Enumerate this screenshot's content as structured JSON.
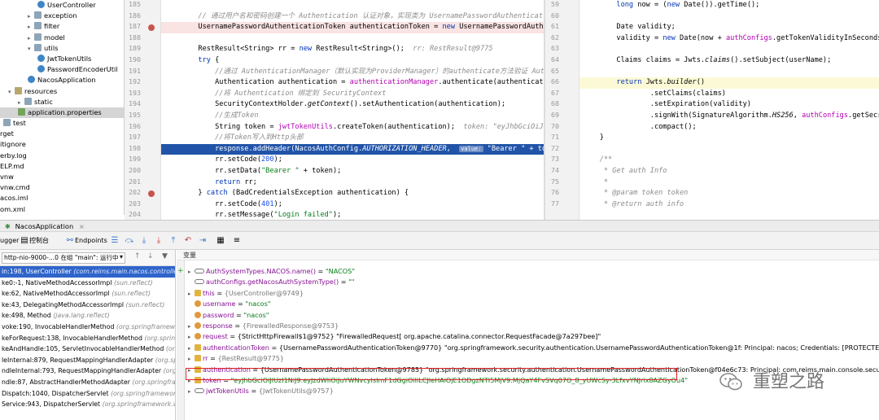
{
  "tree": {
    "items": [
      {
        "label": "UserController",
        "icon": "class-icon",
        "indent": 3
      },
      {
        "label": "exception",
        "icon": "folder-icon",
        "arrow": "▸",
        "indent": 2
      },
      {
        "label": "filter",
        "icon": "folder-icon",
        "arrow": "▸",
        "indent": 2
      },
      {
        "label": "model",
        "icon": "folder-icon",
        "arrow": "▸",
        "indent": 2
      },
      {
        "label": "utils",
        "icon": "folder-icon",
        "arrow": "▾",
        "indent": 2
      },
      {
        "label": "JwtTokenUtils",
        "icon": "class-icon",
        "indent": 3
      },
      {
        "label": "PasswordEncoderUtil",
        "icon": "class-icon",
        "indent": 3
      },
      {
        "label": "NacosApplication",
        "icon": "class-icon",
        "indent": 2
      },
      {
        "label": "resources",
        "icon": "resources-icon",
        "arrow": "▾",
        "indent": 0
      },
      {
        "label": "static",
        "icon": "folder-icon",
        "arrow": "▸",
        "indent": 1
      },
      {
        "label": "application.properties",
        "icon": "properties-icon",
        "indent": 1,
        "selected": true
      },
      {
        "label": "test",
        "icon": "folder-icon",
        "indent": -1
      },
      {
        "label": "rget",
        "icon": "",
        "indent": -2
      },
      {
        "label": "itignore",
        "icon": "",
        "indent": -2
      },
      {
        "label": "erby.log",
        "icon": "",
        "indent": -2
      },
      {
        "label": "ELP.md",
        "icon": "",
        "indent": -2
      },
      {
        "label": "vnw",
        "icon": "",
        "indent": -2
      },
      {
        "label": "vnw.cmd",
        "icon": "",
        "indent": -2
      },
      {
        "label": "acos.iml",
        "icon": "",
        "indent": -2
      },
      {
        "label": "om.xml",
        "icon": "",
        "indent": -2
      }
    ]
  },
  "editor_left": {
    "line_numbers": [
      "185",
      "186",
      "187",
      "188",
      "189",
      "190",
      "191",
      "192",
      "193",
      "194",
      "195",
      "196",
      "197",
      "198",
      "199",
      "200",
      "201",
      "202",
      "203",
      "204"
    ],
    "breakpoints": [
      "187",
      "202"
    ],
    "lines": [
      {
        "html_class": "",
        "parts": []
      },
      {
        "html_class": "",
        "parts": [
          {
            "c": "cm",
            "t": "        // 通过用户名和密码创建一个 Authentication 认证对象，实现类为 UsernamePasswordAuthenticat"
          }
        ]
      },
      {
        "html_class": "err",
        "parts": [
          {
            "c": "",
            "t": "        UsernamePasswordAuthenticationToken authenticationToken = "
          },
          {
            "c": "kw",
            "t": "new"
          },
          {
            "c": "",
            "t": " UsernamePasswordAuth"
          }
        ]
      },
      {
        "html_class": "",
        "parts": []
      },
      {
        "html_class": "",
        "parts": [
          {
            "c": "",
            "t": "        RestResult<String> rr = "
          },
          {
            "c": "kw",
            "t": "new"
          },
          {
            "c": "",
            "t": " RestResult<String>();  "
          },
          {
            "c": "hint",
            "t": "rr: RestResult@9775"
          }
        ]
      },
      {
        "html_class": "",
        "parts": [
          {
            "c": "kw",
            "t": "        try"
          },
          {
            "c": "",
            "t": " {"
          }
        ]
      },
      {
        "html_class": "",
        "parts": [
          {
            "c": "cm",
            "t": "            //通过 AuthenticationManager（默认实现为ProviderManager）的authenticate方法验证 Aut"
          }
        ]
      },
      {
        "html_class": "",
        "parts": [
          {
            "c": "",
            "t": "            Authentication authentication = "
          },
          {
            "c": "fn",
            "t": "authenticationManager"
          },
          {
            "c": "",
            "t": ".authenticate(authenticati"
          }
        ]
      },
      {
        "html_class": "",
        "parts": [
          {
            "c": "cm",
            "t": "            //将 Authentication 绑定到 SecurityContext"
          }
        ]
      },
      {
        "html_class": "",
        "parts": [
          {
            "c": "",
            "t": "            SecurityContextHolder."
          },
          {
            "c": "it",
            "t": "getContext"
          },
          {
            "c": "",
            "t": "().setAuthentication(authentication);"
          }
        ]
      },
      {
        "html_class": "",
        "parts": [
          {
            "c": "cm",
            "t": "            //生成Token"
          }
        ]
      },
      {
        "html_class": "",
        "parts": [
          {
            "c": "",
            "t": "            String token = "
          },
          {
            "c": "fn",
            "t": "jwtTokenUtils"
          },
          {
            "c": "",
            "t": ".createToken(authentication);  "
          },
          {
            "c": "hint",
            "t": "token: \"eyJhbGciOiJ"
          }
        ]
      },
      {
        "html_class": "",
        "parts": [
          {
            "c": "cm",
            "t": "            //将Token写入到Http头部"
          }
        ]
      },
      {
        "html_class": "cur",
        "parts": [
          {
            "c": "",
            "t": "            response.addHeader(NacosAuthConfig."
          },
          {
            "c": "it",
            "t": "AUTHORIZATION_HEADER"
          },
          {
            "c": "",
            "t": ",  "
          },
          {
            "c": "valchip",
            "t": "value:"
          },
          {
            "c": "",
            "t": " \"Bearer \" + tok"
          }
        ]
      },
      {
        "html_class": "",
        "parts": [
          {
            "c": "",
            "t": "            rr.setCode("
          },
          {
            "c": "nm",
            "t": "200"
          },
          {
            "c": "",
            "t": ");"
          }
        ]
      },
      {
        "html_class": "",
        "parts": [
          {
            "c": "",
            "t": "            rr.setData("
          },
          {
            "c": "st",
            "t": "\"Bearer \""
          },
          {
            "c": "",
            "t": " + token);"
          }
        ]
      },
      {
        "html_class": "",
        "parts": [
          {
            "c": "kw",
            "t": "            return"
          },
          {
            "c": "",
            "t": " rr;"
          }
        ]
      },
      {
        "html_class": "",
        "parts": [
          {
            "c": "",
            "t": "        } "
          },
          {
            "c": "kw",
            "t": "catch"
          },
          {
            "c": "",
            "t": " (BadCredentialsException authentication) {"
          }
        ]
      },
      {
        "html_class": "",
        "parts": [
          {
            "c": "",
            "t": "            rr.setCode("
          },
          {
            "c": "nm",
            "t": "401"
          },
          {
            "c": "",
            "t": ");"
          }
        ]
      },
      {
        "html_class": "",
        "parts": [
          {
            "c": "",
            "t": "            rr.setMessage("
          },
          {
            "c": "st",
            "t": "\"Login failed\""
          },
          {
            "c": "",
            "t": ");"
          }
        ]
      }
    ]
  },
  "editor_right": {
    "line_numbers": [
      "59",
      "60",
      "61",
      "62",
      "63",
      "64",
      "65",
      "66",
      "67",
      "68",
      "69",
      "70",
      "71",
      "72",
      "73",
      "74",
      "75",
      "76",
      "77"
    ],
    "lines": [
      {
        "html_class": "",
        "parts": [
          {
            "c": "",
            "t": "        "
          },
          {
            "c": "kw",
            "t": "long"
          },
          {
            "c": "",
            "t": " now = ("
          },
          {
            "c": "kw",
            "t": "new"
          },
          {
            "c": "",
            "t": " Date()).getTime();"
          }
        ]
      },
      {
        "html_class": "",
        "parts": []
      },
      {
        "html_class": "",
        "parts": [
          {
            "c": "",
            "t": "        Date validity;"
          }
        ]
      },
      {
        "html_class": "",
        "parts": [
          {
            "c": "",
            "t": "        validity = "
          },
          {
            "c": "kw",
            "t": "new"
          },
          {
            "c": "",
            "t": " Date(now + "
          },
          {
            "c": "fn",
            "t": "authConfigs"
          },
          {
            "c": "",
            "t": ".getTokenValidityInSeconds"
          }
        ]
      },
      {
        "html_class": "",
        "parts": []
      },
      {
        "html_class": "",
        "parts": [
          {
            "c": "",
            "t": "        Claims claims = Jwts."
          },
          {
            "c": "it",
            "t": "claims"
          },
          {
            "c": "",
            "t": "().setSubject(userName);"
          }
        ]
      },
      {
        "html_class": "",
        "parts": []
      },
      {
        "html_class": "cur2",
        "parts": [
          {
            "c": "kw",
            "t": "        return"
          },
          {
            "c": "",
            "t": " Jwts."
          },
          {
            "c": "it",
            "t": "builder"
          },
          {
            "c": "",
            "t": "()"
          }
        ]
      },
      {
        "html_class": "",
        "parts": [
          {
            "c": "",
            "t": "                .setClaims(claims)"
          }
        ]
      },
      {
        "html_class": "",
        "parts": [
          {
            "c": "",
            "t": "                .setExpiration(validity)"
          }
        ]
      },
      {
        "html_class": "",
        "parts": [
          {
            "c": "",
            "t": "                ."
          },
          {
            "c": "",
            "t": "signWith"
          },
          {
            "c": "",
            "t": "(SignatureAlgorithm."
          },
          {
            "c": "it",
            "t": "HS256"
          },
          {
            "c": "",
            "t": ", "
          },
          {
            "c": "fn",
            "t": "authConfigs"
          },
          {
            "c": "",
            "t": ".getSecretKe"
          }
        ]
      },
      {
        "html_class": "",
        "parts": [
          {
            "c": "",
            "t": "                .compact();"
          }
        ]
      },
      {
        "html_class": "",
        "parts": [
          {
            "c": "",
            "t": "    }"
          }
        ]
      },
      {
        "html_class": "",
        "parts": []
      },
      {
        "html_class": "",
        "parts": [
          {
            "c": "cm",
            "t": "    /**"
          }
        ]
      },
      {
        "html_class": "",
        "parts": [
          {
            "c": "cm",
            "t": "     * Get auth Info"
          }
        ]
      },
      {
        "html_class": "",
        "parts": [
          {
            "c": "cm",
            "t": "     *"
          }
        ]
      },
      {
        "html_class": "",
        "parts": [
          {
            "c": "cm",
            "t": "     * @param token token"
          }
        ]
      },
      {
        "html_class": "",
        "parts": [
          {
            "c": "cm",
            "t": "     * @return auth info"
          }
        ]
      }
    ]
  },
  "debug_tab": "NacosApplication",
  "toolbar": {
    "debugger": "ugger",
    "console": "控制台",
    "endpoints": "Endpoints"
  },
  "frames": {
    "thread": "http-nio-9000-...0 在组 \"main\": 运行中",
    "items": [
      {
        "m": "in:198, UserController",
        "p": "(com.reims.main.nacos.controller)",
        "sel": true
      },
      {
        "m": "ke0:-1, NativeMethodAccessorImpl",
        "p": "(sun.reflect)"
      },
      {
        "m": "ke:62, NativeMethodAccessorImpl",
        "p": "(sun.reflect)"
      },
      {
        "m": "ke:43, DelegatingMethodAccessorImpl",
        "p": "(sun.reflect)"
      },
      {
        "m": "ke:498, Method",
        "p": "(java.lang.reflect)"
      },
      {
        "m": "voke:190, InvocableHandlerMethod",
        "p": "(org.springframew"
      },
      {
        "m": "keForRequest:138, InvocableHandlerMethod",
        "p": "(org.spring"
      },
      {
        "m": "keAndHandle:105, ServletInvocableHandlerMethod",
        "p": "(org.spri"
      },
      {
        "m": "leInternal:879, RequestMappingHandlerAdapter",
        "p": "(org.spr"
      },
      {
        "m": "ndleInternal:793, RequestMappingHandlerAdapter",
        "p": "(org.sp"
      },
      {
        "m": "ndle:87, AbstractHandlerMethodAdapter",
        "p": "(org.springframe"
      },
      {
        "m": "Dispatch:1040, DispatcherServlet",
        "p": "(org.springframework"
      },
      {
        "m": "Service:943, DispatcherServlet",
        "p": "(org.springframework.web"
      }
    ]
  },
  "vars": {
    "header": "变量",
    "items": [
      {
        "icon": "watch",
        "name": "AuthSystemTypes.NACOS.name()",
        "eq": " = ",
        "val": "\"NACOS\"",
        "vclass": "vs",
        "arrow": "▸"
      },
      {
        "icon": "watch",
        "name": "authConfigs.getNacosAuthSystemType()",
        "eq": " = ",
        "val": "\"\"",
        "vclass": "vs",
        "arrow": ""
      },
      {
        "icon": "local",
        "name": "this",
        "eq": " = ",
        "val": "{UserController@9749}",
        "vclass": "vg",
        "arrow": "▸"
      },
      {
        "icon": "field",
        "name": "username",
        "eq": " = ",
        "val": "\"nacos\"",
        "vclass": "vs",
        "arrow": ""
      },
      {
        "icon": "field",
        "name": "password",
        "eq": " = ",
        "val": "\"nacos\"",
        "vclass": "vs",
        "arrow": ""
      },
      {
        "icon": "field",
        "name": "response",
        "eq": " = ",
        "val": "{FirewalledResponse@9753}",
        "vclass": "vg",
        "arrow": "▸"
      },
      {
        "icon": "field",
        "name": "request",
        "eq": " = ",
        "val": "{StrictHttpFirewall$1@9752} \"FirewalledRequest[ org.apache.catalina.connector.RequestFacade@7a297bee]\"",
        "vclass": "va",
        "arrow": "▸"
      },
      {
        "icon": "local",
        "name": "authenticationToken",
        "eq": " = ",
        "val": "{UsernamePasswordAuthenticationToken@9770} \"org.springframework.security.authentication.UsernamePasswordAuthenticationToken@1f: Principal: nacos; Credentials: [PROTECTED]; Authenticate",
        "vclass": "va",
        "arrow": "▸"
      },
      {
        "icon": "local",
        "name": "rr",
        "eq": " = ",
        "val": "{RestResult@9775}",
        "vclass": "vg",
        "arrow": "▸"
      },
      {
        "icon": "local",
        "name": "authentication",
        "eq": " = ",
        "val": "{UsernamePasswordAuthenticationToken@9785} \"org.springframework.security.authentication.UsernamePasswordAuthenticationToken@f04e6c73: Principal: com.reims.main.console.security.nacos.users.",
        "vclass": "va",
        "arrow": "▸"
      },
      {
        "icon": "local",
        "name": "token",
        "eq": " = ",
        "val": "\"eyJhbGciOiJIUzI1NiJ9.eyJzdWIiOiJuYWNvcyIsImF1dGgiOiIiLCJleHAiOjE1ODgzNTI5MjV9.MjQaY4FvSVq07O_8_yUWcSy-3LfxvYNJrix8AZGyOu4\"",
        "vclass": "vs",
        "arrow": "▸"
      },
      {
        "icon": "watch",
        "name": "jwtTokenUtils",
        "eq": " = ",
        "val": "{JwtTokenUtils@9757}",
        "vclass": "vg",
        "arrow": "▸"
      }
    ]
  },
  "watermark": "重塑之路",
  "colors": {
    "breakpoint": "#c75450",
    "current_line": "#2154a8",
    "selected_frame": "#2f65ca",
    "token_highlight": "#e02020"
  }
}
